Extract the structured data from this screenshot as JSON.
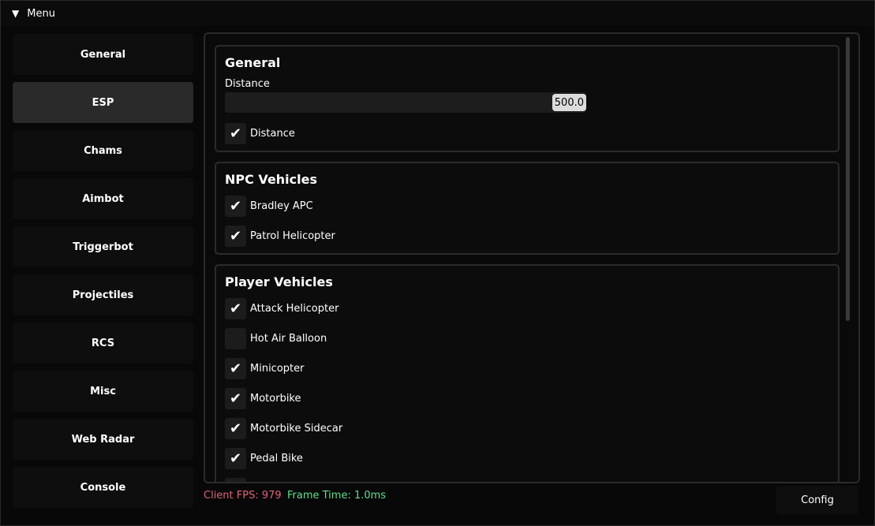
{
  "window": {
    "title": "Menu"
  },
  "sidebar": {
    "items": [
      {
        "label": "General",
        "active": false
      },
      {
        "label": "ESP",
        "active": true
      },
      {
        "label": "Chams",
        "active": false
      },
      {
        "label": "Aimbot",
        "active": false
      },
      {
        "label": "Triggerbot",
        "active": false
      },
      {
        "label": "Projectiles",
        "active": false
      },
      {
        "label": "RCS",
        "active": false
      },
      {
        "label": "Misc",
        "active": false
      },
      {
        "label": "Web Radar",
        "active": false
      },
      {
        "label": "Console",
        "active": false
      }
    ]
  },
  "content": {
    "general": {
      "title": "General",
      "slider_label": "Distance",
      "slider_value": "500.0",
      "checks": [
        {
          "label": "Distance",
          "checked": true
        }
      ]
    },
    "npc_vehicles": {
      "title": "NPC Vehicles",
      "checks": [
        {
          "label": "Bradley APC",
          "checked": true
        },
        {
          "label": "Patrol Helicopter",
          "checked": true
        }
      ]
    },
    "player_vehicles": {
      "title": "Player Vehicles",
      "checks": [
        {
          "label": "Attack Helicopter",
          "checked": true
        },
        {
          "label": "Hot Air Balloon",
          "checked": false
        },
        {
          "label": "Minicopter",
          "checked": true
        },
        {
          "label": "Motorbike",
          "checked": true
        },
        {
          "label": "Motorbike Sidecar",
          "checked": true
        },
        {
          "label": "Pedal Bike",
          "checked": true
        }
      ]
    }
  },
  "status": {
    "fps": "Client FPS: 979",
    "fps_color": "#e0607a",
    "frame_time": "Frame Time: 1.0ms",
    "frame_time_color": "#5fe08a"
  },
  "config_label": "Config",
  "icons": {
    "collapse": "triangle-down-icon",
    "check": "checkmark-icon"
  }
}
